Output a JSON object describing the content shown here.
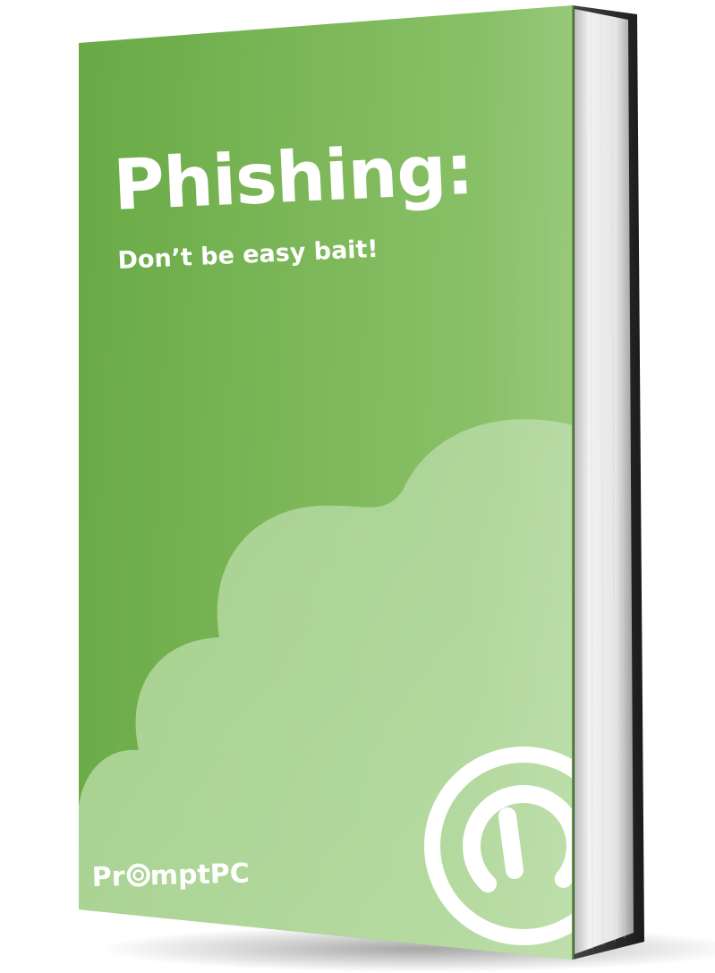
{
  "cover": {
    "title": "Phishing:",
    "subtitle": "Don’t be easy bait!"
  },
  "brand": {
    "logo_text_pre": "Pr",
    "logo_text_post": "mptPC",
    "logo_icon": "power-icon"
  },
  "colors": {
    "cover_green_dark": "#6aab48",
    "cover_green_light": "#84bd64",
    "cloud_green": "#acd496",
    "text": "#ffffff",
    "spine": "#2a2a2a",
    "pages": "#eeeeee"
  }
}
